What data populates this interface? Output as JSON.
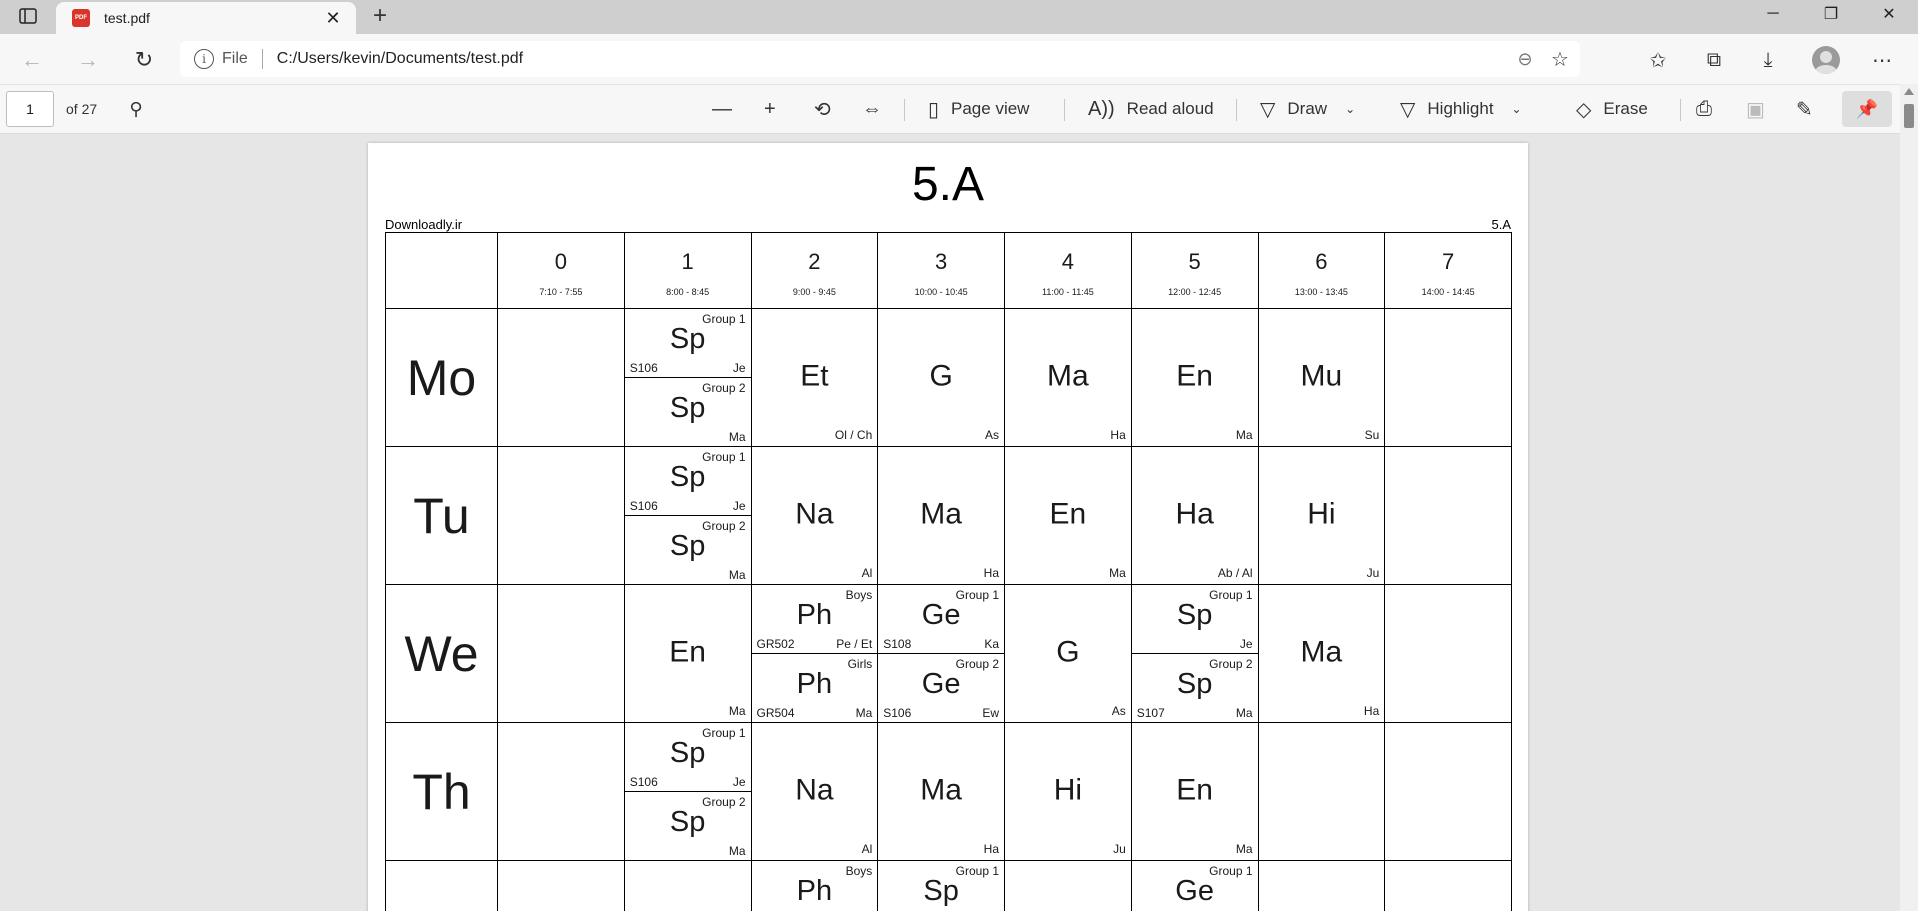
{
  "tab": {
    "title": "test.pdf",
    "pdf_badge": "PDF",
    "close_glyph": "✕",
    "new_tab_glyph": "+"
  },
  "window": {
    "minimize": "─",
    "restore": "❐",
    "close": "✕"
  },
  "address": {
    "file_label": "File",
    "url": "C:/Users/kevin/Documents/test.pdf"
  },
  "pdf_toolbar": {
    "page_current": "1",
    "page_count": "of 27",
    "page_view": "Page view",
    "read_aloud": "Read aloud",
    "draw": "Draw",
    "highlight": "Highlight",
    "erase": "Erase"
  },
  "document": {
    "title": "5.A",
    "watermark": "Downloadly.ir",
    "corner_label": "5.A",
    "periods": [
      {
        "num": "0",
        "time": "7:10 - 7:55"
      },
      {
        "num": "1",
        "time": "8:00 - 8:45"
      },
      {
        "num": "2",
        "time": "9:00 - 9:45"
      },
      {
        "num": "3",
        "time": "10:00 - 10:45"
      },
      {
        "num": "4",
        "time": "11:00 - 11:45"
      },
      {
        "num": "5",
        "time": "12:00 - 12:45"
      },
      {
        "num": "6",
        "time": "13:00 - 13:45"
      },
      {
        "num": "7",
        "time": "14:00 - 14:45"
      }
    ],
    "days": [
      {
        "name": "Mo",
        "cells": [
          null,
          {
            "split": [
              {
                "label": "Group 1",
                "subject": "Sp",
                "room": "S106",
                "teacher": "Je"
              },
              {
                "label": "Group 2",
                "subject": "Sp",
                "room": "",
                "teacher": "Ma"
              }
            ]
          },
          {
            "subject": "Et",
            "teacher": "Ol / Ch"
          },
          {
            "subject": "G",
            "teacher": "As"
          },
          {
            "subject": "Ma",
            "teacher": "Ha"
          },
          {
            "subject": "En",
            "teacher": "Ma"
          },
          {
            "subject": "Mu",
            "teacher": "Su"
          },
          null
        ]
      },
      {
        "name": "Tu",
        "cells": [
          null,
          {
            "split": [
              {
                "label": "Group 1",
                "subject": "Sp",
                "room": "S106",
                "teacher": "Je"
              },
              {
                "label": "Group 2",
                "subject": "Sp",
                "room": "",
                "teacher": "Ma"
              }
            ]
          },
          {
            "subject": "Na",
            "teacher": "Al"
          },
          {
            "subject": "Ma",
            "teacher": "Ha"
          },
          {
            "subject": "En",
            "teacher": "Ma"
          },
          {
            "subject": "Ha",
            "teacher": "Ab / Al"
          },
          {
            "subject": "Hi",
            "teacher": "Ju"
          },
          null
        ]
      },
      {
        "name": "We",
        "cells": [
          null,
          {
            "subject": "En",
            "teacher": "Ma"
          },
          {
            "split": [
              {
                "label": "Boys",
                "subject": "Ph",
                "room": "GR502",
                "teacher": "Pe / Et"
              },
              {
                "label": "Girls",
                "subject": "Ph",
                "room": "GR504",
                "teacher": "Ma"
              }
            ]
          },
          {
            "split": [
              {
                "label": "Group 1",
                "subject": "Ge",
                "room": "S108",
                "teacher": "Ka"
              },
              {
                "label": "Group 2",
                "subject": "Ge",
                "room": "S106",
                "teacher": "Ew"
              }
            ]
          },
          {
            "subject": "G",
            "teacher": "As"
          },
          {
            "split": [
              {
                "label": "Group 1",
                "subject": "Sp",
                "room": "",
                "teacher": "Je"
              },
              {
                "label": "Group 2",
                "subject": "Sp",
                "room": "S107",
                "teacher": "Ma"
              }
            ]
          },
          {
            "subject": "Ma",
            "teacher": "Ha"
          },
          null
        ]
      },
      {
        "name": "Th",
        "cells": [
          null,
          {
            "split": [
              {
                "label": "Group 1",
                "subject": "Sp",
                "room": "S106",
                "teacher": "Je"
              },
              {
                "label": "Group 2",
                "subject": "Sp",
                "room": "",
                "teacher": "Ma"
              }
            ]
          },
          {
            "subject": "Na",
            "teacher": "Al"
          },
          {
            "subject": "Ma",
            "teacher": "Ha"
          },
          {
            "subject": "Hi",
            "teacher": "Ju"
          },
          {
            "subject": "En",
            "teacher": "Ma"
          },
          null,
          null
        ]
      },
      {
        "name": "",
        "partial": true,
        "cells": [
          null,
          null,
          {
            "label": "Boys",
            "subject": "Ph"
          },
          {
            "label": "Group 1",
            "subject": "Sp"
          },
          null,
          {
            "label": "Group 1",
            "subject": "Ge"
          },
          null,
          null
        ]
      }
    ]
  }
}
